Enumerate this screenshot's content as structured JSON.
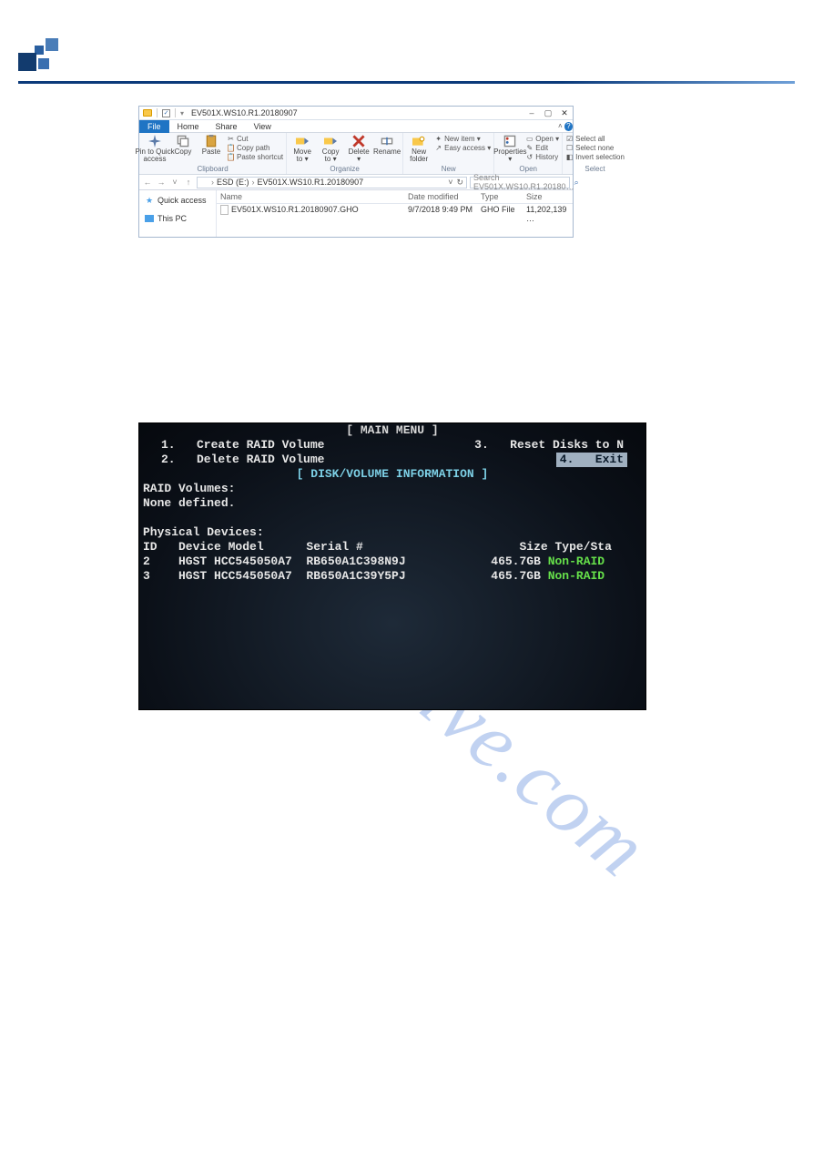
{
  "watermark": "manualshive.com",
  "explorer": {
    "title": "EV501X.WS10.R1.20180907",
    "win_controls": {
      "min": "–",
      "max": "▢",
      "close": "✕"
    },
    "tabs": {
      "file": "File",
      "home": "Home",
      "share": "Share",
      "view": "View"
    },
    "ribbon": {
      "clipboard": {
        "pin": "Pin to Quick\naccess",
        "copy": "Copy",
        "paste": "Paste",
        "cut": "Cut",
        "copy_path": "Copy path",
        "paste_shortcut": "Paste shortcut",
        "title": "Clipboard"
      },
      "organize": {
        "move_to": "Move\nto ▾",
        "copy_to": "Copy\nto ▾",
        "delete": "Delete\n▾",
        "rename": "Rename",
        "title": "Organize"
      },
      "new": {
        "new_folder": "New\nfolder",
        "new_item": "New item ▾",
        "easy_access": "Easy access ▾",
        "title": "New"
      },
      "open": {
        "properties": "Properties\n▾",
        "open": "Open ▾",
        "edit": "Edit",
        "history": "History",
        "title": "Open"
      },
      "select": {
        "select_all": "Select all",
        "select_none": "Select none",
        "invert": "Invert selection",
        "title": "Select"
      }
    },
    "nav": {
      "back": "←",
      "fwd": "→",
      "up": "↑",
      "drop": "˅",
      "refresh": "↻",
      "crumb1": "ESD (E:)",
      "crumb2": "EV501X.WS10.R1.20180907",
      "sep": "›"
    },
    "search": {
      "placeholder": "Search EV501X.WS10.R1.20180…",
      "icon": "⌕"
    },
    "sidebar": {
      "quick_access": "Quick access",
      "this_pc": "This PC"
    },
    "columns": {
      "name": "Name",
      "date": "Date modified",
      "type": "Type",
      "size": "Size"
    },
    "files": [
      {
        "name": "EV501X.WS10.R1.20180907.GHO",
        "date": "9/7/2018 9:49 PM",
        "type": "GHO File",
        "size": "11,202,139 …"
      }
    ]
  },
  "bios": {
    "main_menu_hdr": "[ MAIN MENU ]",
    "opt1": "1.   Create RAID Volume",
    "opt2": "2.   Delete RAID Volume",
    "opt3": "3.   Reset Disks to N",
    "opt4": "4.   Exit",
    "info_hdr": "[ DISK/VOLUME INFORMATION ]",
    "vol_label": "RAID Volumes:",
    "vol_none": "None defined.",
    "phys_label": "Physical Devices:",
    "cols": "ID   Device Model      Serial #                      Size Type/Sta",
    "row1_a": "2    HGST HCC545050A7  RB650A1C398N9J            465.7GB ",
    "row1_b": "Non-RAID",
    "row2_a": "3    HGST HCC545050A7  RB650A1C39Y5PJ            465.7GB ",
    "row2_b": "Non-RAID"
  }
}
